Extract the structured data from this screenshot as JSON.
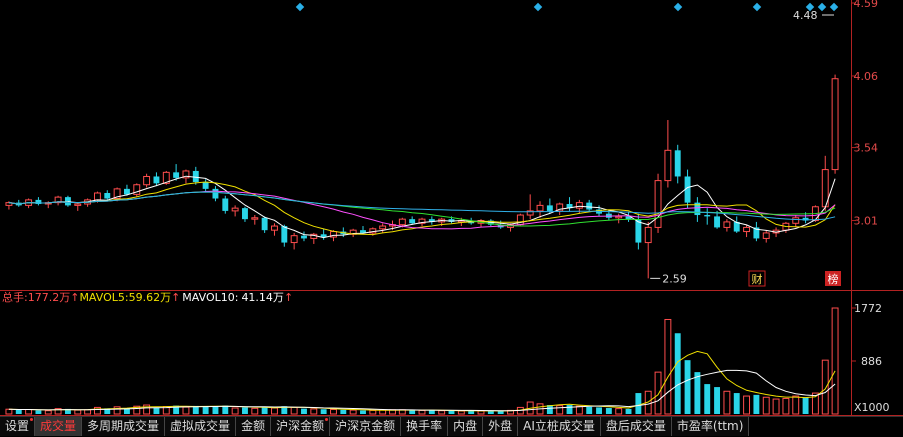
{
  "price_axis": {
    "ticks": [
      "4.59",
      "4.06",
      "3.54",
      "3.01"
    ],
    "colors": {
      "tick": "#e34a4a",
      "frame": "#b22222",
      "up": "#ff4d4d",
      "down": "#2ad5e8"
    }
  },
  "annotations": {
    "high": "4.48",
    "low": "2.59",
    "badge_cai": "财",
    "badge_bang": "榜"
  },
  "volume_axis": {
    "ticks": [
      "1772",
      "886"
    ],
    "unit": "X1000"
  },
  "volume_legend": {
    "total": {
      "label": "总手:",
      "value": "177.2万",
      "color": "#ff4d4d"
    },
    "ma5": {
      "label": "MAVOL5:",
      "value": "59.62万",
      "color": "#f0e000"
    },
    "ma10": {
      "label": "MAVOL10:",
      "value": "41.14万",
      "color": "#ffffff"
    }
  },
  "tabs": [
    {
      "label": "设置",
      "dot": true,
      "active": false
    },
    {
      "label": "成交量",
      "dot": false,
      "active": true
    },
    {
      "label": "多周期成交量",
      "dot": false,
      "active": false
    },
    {
      "label": "虚拟成交量",
      "dot": false,
      "active": false
    },
    {
      "label": "金额",
      "dot": false,
      "active": false
    },
    {
      "label": "沪深金额",
      "dot": true,
      "active": false
    },
    {
      "label": "沪深京金额",
      "dot": false,
      "active": false
    },
    {
      "label": "换手率",
      "dot": false,
      "active": false
    },
    {
      "label": "内盘",
      "dot": false,
      "active": false
    },
    {
      "label": "外盘",
      "dot": false,
      "active": false
    },
    {
      "label": "AI立桩成交量",
      "dot": false,
      "active": false
    },
    {
      "label": "盘后成交量",
      "dot": false,
      "active": false
    },
    {
      "label": "市盈率(ttm)",
      "dot": false,
      "active": false
    }
  ],
  "chart_data": {
    "type": "candlestick",
    "price_range": [
      2.52,
      4.59
    ],
    "volume_range": [
      0,
      1772
    ],
    "candles": [
      [
        3.12,
        3.15,
        3.09,
        3.14,
        80
      ],
      [
        3.14,
        3.16,
        3.11,
        3.12,
        70
      ],
      [
        3.12,
        3.17,
        3.1,
        3.16,
        75
      ],
      [
        3.16,
        3.18,
        3.12,
        3.13,
        60
      ],
      [
        3.13,
        3.15,
        3.1,
        3.14,
        55
      ],
      [
        3.14,
        3.19,
        3.12,
        3.18,
        90
      ],
      [
        3.18,
        3.19,
        3.11,
        3.12,
        85
      ],
      [
        3.12,
        3.14,
        3.08,
        3.13,
        65
      ],
      [
        3.13,
        3.17,
        3.11,
        3.16,
        70
      ],
      [
        3.16,
        3.22,
        3.14,
        3.21,
        110
      ],
      [
        3.21,
        3.23,
        3.16,
        3.17,
        95
      ],
      [
        3.17,
        3.25,
        3.15,
        3.24,
        120
      ],
      [
        3.24,
        3.27,
        3.19,
        3.2,
        100
      ],
      [
        3.2,
        3.28,
        3.18,
        3.27,
        130
      ],
      [
        3.27,
        3.35,
        3.25,
        3.33,
        150
      ],
      [
        3.33,
        3.36,
        3.26,
        3.28,
        110
      ],
      [
        3.28,
        3.37,
        3.27,
        3.36,
        125
      ],
      [
        3.36,
        3.42,
        3.3,
        3.32,
        140
      ],
      [
        3.32,
        3.38,
        3.28,
        3.37,
        115
      ],
      [
        3.37,
        3.4,
        3.27,
        3.29,
        135
      ],
      [
        3.29,
        3.31,
        3.22,
        3.24,
        120
      ],
      [
        3.24,
        3.26,
        3.15,
        3.17,
        130
      ],
      [
        3.17,
        3.19,
        3.06,
        3.08,
        140
      ],
      [
        3.08,
        3.12,
        3.04,
        3.1,
        100
      ],
      [
        3.1,
        3.11,
        3.0,
        3.02,
        110
      ],
      [
        3.02,
        3.05,
        2.98,
        3.03,
        95
      ],
      [
        3.03,
        3.04,
        2.92,
        2.94,
        120
      ],
      [
        2.94,
        2.99,
        2.9,
        2.97,
        100
      ],
      [
        2.97,
        2.98,
        2.82,
        2.85,
        130
      ],
      [
        2.85,
        2.92,
        2.8,
        2.9,
        110
      ],
      [
        2.9,
        2.93,
        2.86,
        2.88,
        90
      ],
      [
        2.88,
        2.92,
        2.84,
        2.91,
        85
      ],
      [
        2.91,
        2.95,
        2.87,
        2.89,
        80
      ],
      [
        2.89,
        2.94,
        2.86,
        2.93,
        75
      ],
      [
        2.93,
        2.96,
        2.89,
        2.91,
        70
      ],
      [
        2.91,
        2.95,
        2.89,
        2.94,
        65
      ],
      [
        2.94,
        2.97,
        2.91,
        2.92,
        60
      ],
      [
        2.92,
        2.96,
        2.9,
        2.95,
        60
      ],
      [
        2.95,
        2.99,
        2.92,
        2.97,
        65
      ],
      [
        2.97,
        3.01,
        2.94,
        2.98,
        70
      ],
      [
        2.98,
        3.03,
        2.96,
        3.02,
        70
      ],
      [
        3.02,
        3.04,
        2.98,
        2.99,
        65
      ],
      [
        2.99,
        3.03,
        2.97,
        3.02,
        60
      ],
      [
        3.02,
        3.04,
        2.98,
        3.0,
        60
      ],
      [
        3.0,
        3.03,
        2.97,
        3.02,
        55
      ],
      [
        3.02,
        3.04,
        2.99,
        3.0,
        55
      ],
      [
        3.0,
        3.03,
        2.97,
        3.01,
        50
      ],
      [
        3.01,
        3.03,
        2.98,
        2.99,
        50
      ],
      [
        2.99,
        3.02,
        2.96,
        3.01,
        50
      ],
      [
        3.01,
        3.02,
        2.97,
        2.98,
        55
      ],
      [
        2.98,
        3.01,
        2.95,
        2.96,
        55
      ],
      [
        2.96,
        2.99,
        2.93,
        2.98,
        60
      ],
      [
        2.98,
        3.06,
        2.97,
        3.05,
        110
      ],
      [
        3.05,
        3.2,
        3.02,
        3.08,
        200
      ],
      [
        3.08,
        3.15,
        3.03,
        3.12,
        170
      ],
      [
        3.12,
        3.17,
        3.06,
        3.08,
        150
      ],
      [
        3.08,
        3.14,
        3.05,
        3.13,
        140
      ],
      [
        3.13,
        3.18,
        3.08,
        3.1,
        150
      ],
      [
        3.1,
        3.16,
        3.06,
        3.14,
        130
      ],
      [
        3.14,
        3.16,
        3.08,
        3.09,
        120
      ],
      [
        3.09,
        3.12,
        3.04,
        3.06,
        110
      ],
      [
        3.06,
        3.09,
        3.01,
        3.03,
        100
      ],
      [
        3.03,
        3.06,
        2.99,
        3.04,
        90
      ],
      [
        3.04,
        3.07,
        3.0,
        3.02,
        85
      ],
      [
        3.02,
        3.06,
        2.8,
        2.85,
        350
      ],
      [
        2.85,
        3.0,
        2.59,
        2.96,
        380
      ],
      [
        2.96,
        3.35,
        2.92,
        3.3,
        700
      ],
      [
        3.3,
        3.74,
        3.25,
        3.52,
        1580
      ],
      [
        3.52,
        3.56,
        3.28,
        3.33,
        1350
      ],
      [
        3.33,
        3.38,
        3.1,
        3.14,
        900
      ],
      [
        3.14,
        3.18,
        3.0,
        3.05,
        700
      ],
      [
        3.05,
        3.1,
        2.98,
        3.04,
        500
      ],
      [
        3.04,
        3.08,
        2.95,
        2.96,
        450
      ],
      [
        2.96,
        3.02,
        2.93,
        3.0,
        380
      ],
      [
        3.0,
        3.04,
        2.92,
        2.93,
        350
      ],
      [
        2.93,
        2.98,
        2.89,
        2.96,
        300
      ],
      [
        2.96,
        3.0,
        2.86,
        2.88,
        320
      ],
      [
        2.88,
        2.94,
        2.85,
        2.92,
        280
      ],
      [
        2.92,
        2.96,
        2.89,
        2.94,
        250
      ],
      [
        2.94,
        3.0,
        2.92,
        2.99,
        260
      ],
      [
        2.99,
        3.05,
        2.96,
        3.03,
        300
      ],
      [
        3.03,
        3.07,
        2.99,
        3.01,
        280
      ],
      [
        3.01,
        3.12,
        3.0,
        3.11,
        350
      ],
      [
        3.11,
        3.48,
        3.08,
        3.38,
        900
      ],
      [
        3.38,
        4.07,
        3.35,
        4.04,
        1772
      ]
    ]
  }
}
